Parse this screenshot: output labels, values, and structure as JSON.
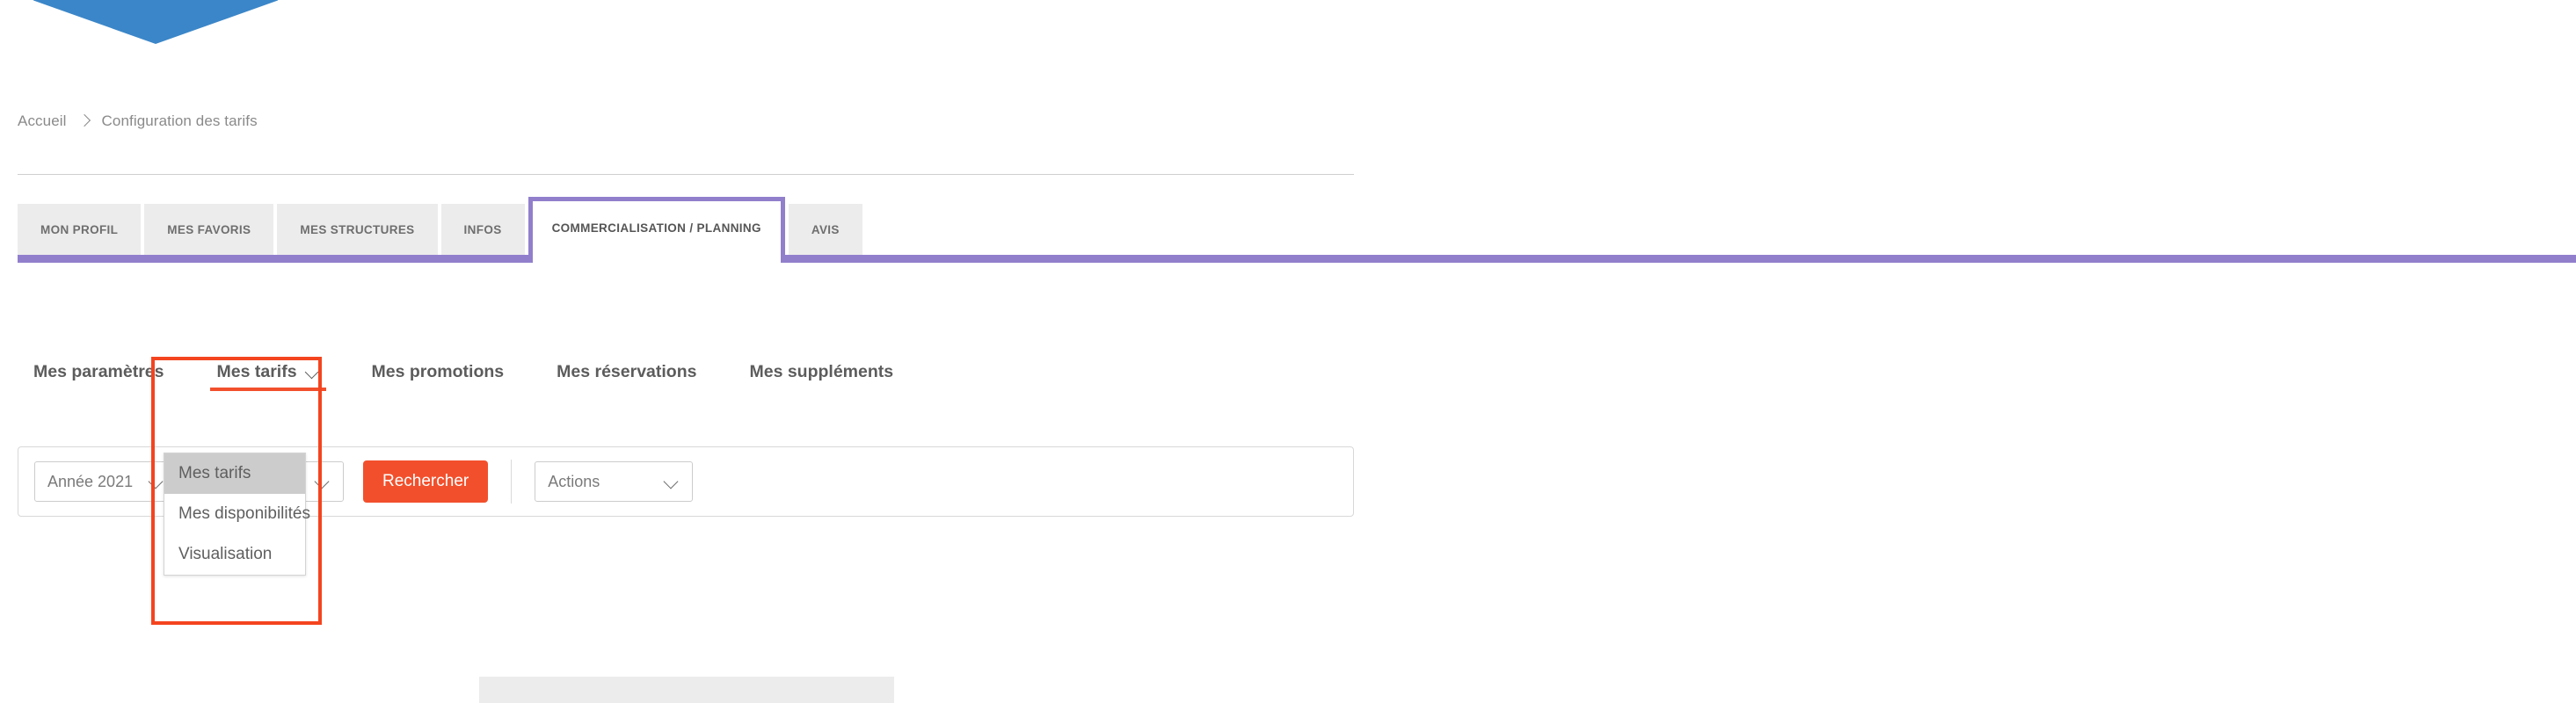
{
  "breadcrumb": {
    "items": [
      {
        "label": "Accueil"
      },
      {
        "label": "Configuration des tarifs"
      }
    ],
    "separator_icon": "chevron-right-icon"
  },
  "primary_tabs": {
    "items": [
      {
        "label": "MON PROFIL",
        "active": false
      },
      {
        "label": "MES FAVORIS",
        "active": false
      },
      {
        "label": "MES STRUCTURES",
        "active": false
      },
      {
        "label": "INFOS",
        "active": false
      },
      {
        "label": "COMMERCIALISATION / PLANNING",
        "active": true
      },
      {
        "label": "AVIS",
        "active": false
      }
    ],
    "active_color": "#917fcc",
    "inactive_bg": "#ececec"
  },
  "sub_nav": {
    "items": [
      {
        "label": "Mes paramètres",
        "active": false,
        "has_chevron": false
      },
      {
        "label": "Mes tarifs",
        "active": true,
        "has_chevron": true
      },
      {
        "label": "Mes promotions",
        "active": false,
        "has_chevron": false
      },
      {
        "label": "Mes réservations",
        "active": false,
        "has_chevron": false
      },
      {
        "label": "Mes suppléments",
        "active": false,
        "has_chevron": false
      }
    ],
    "active_underline_color": "#f2502c",
    "chevron_icon": "chevron-down-icon"
  },
  "dropdown": {
    "open": true,
    "items": [
      {
        "label": "Mes tarifs",
        "highlighted": true
      },
      {
        "label": "Mes disponibilités",
        "highlighted": false
      },
      {
        "label": "Visualisation",
        "highlighted": false
      }
    ],
    "highlight_bg": "#cccccc"
  },
  "filter_bar": {
    "year_select": {
      "value": "Année 2021",
      "chevron_icon": "chevron-down-icon"
    },
    "structure_select": {
      "value": "",
      "chevron_icon": "chevron-down-icon"
    },
    "search_button": {
      "label": "Rechercher",
      "color": "#f2502c"
    },
    "actions_select": {
      "value": "Actions",
      "chevron_icon": "chevron-down-icon"
    }
  },
  "annotation": {
    "color": "#f4441f",
    "shape": "rectangle-highlight"
  },
  "banner": {
    "color": "#3b86c8",
    "shape": "pentagon-down"
  }
}
